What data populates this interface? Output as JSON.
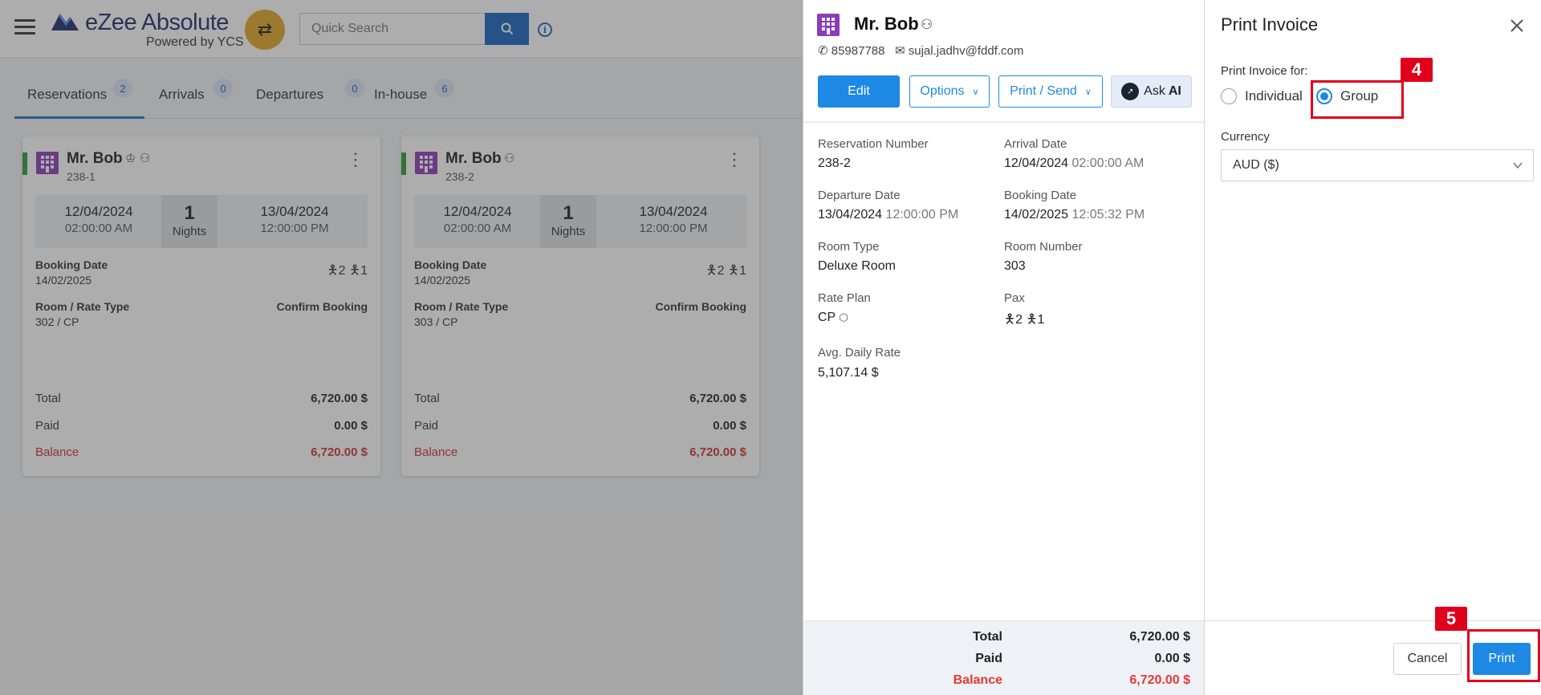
{
  "app": {
    "logo_title": "eZee Absolute",
    "logo_sub": "Powered by YCS",
    "search_placeholder": "Quick Search"
  },
  "tabs": [
    {
      "label": "Reservations",
      "count": "2",
      "active": true
    },
    {
      "label": "Arrivals",
      "count": "0"
    },
    {
      "label": "Departures",
      "count": "0"
    },
    {
      "label": "In-house",
      "count": "6"
    }
  ],
  "cards": [
    {
      "guest": "Mr. Bob",
      "res_no": "238-1",
      "arrival_date": "12/04/2024",
      "arrival_time": "02:00:00 AM",
      "nights": "1",
      "nights_label": "Nights",
      "departure_date": "13/04/2024",
      "departure_time": "12:00:00 PM",
      "booking_date_label": "Booking Date",
      "booking_date": "14/02/2025",
      "adults": "2",
      "children": "1",
      "room_rate_label": "Room / Rate Type",
      "room_rate": "302 / CP",
      "status": "Confirm Booking",
      "total_label": "Total",
      "total": "6,720.00 $",
      "paid_label": "Paid",
      "paid": "0.00 $",
      "balance_label": "Balance",
      "balance": "6,720.00 $"
    },
    {
      "guest": "Mr. Bob",
      "res_no": "238-2",
      "arrival_date": "12/04/2024",
      "arrival_time": "02:00:00 AM",
      "nights": "1",
      "nights_label": "Nights",
      "departure_date": "13/04/2024",
      "departure_time": "12:00:00 PM",
      "booking_date_label": "Booking Date",
      "booking_date": "14/02/2025",
      "adults": "2",
      "children": "1",
      "room_rate_label": "Room / Rate Type",
      "room_rate": "303 / CP",
      "status": "Confirm Booking",
      "total_label": "Total",
      "total": "6,720.00 $",
      "paid_label": "Paid",
      "paid": "0.00 $",
      "balance_label": "Balance",
      "balance": "6,720.00 $"
    }
  ],
  "detail": {
    "name": "Mr. Bob",
    "phone": "85987788",
    "email": "sujal.jadhv@fddf.com",
    "buttons": {
      "edit": "Edit",
      "options": "Options",
      "print_send": "Print / Send",
      "ask": "Ask",
      "ai": "AI"
    },
    "fields": {
      "reservation_number_label": "Reservation Number",
      "reservation_number": "238-2",
      "arrival_date_label": "Arrival Date",
      "arrival_date": "12/04/2024",
      "arrival_time": "02:00:00 AM",
      "departure_date_label": "Departure Date",
      "departure_date": "13/04/2024",
      "departure_time": "12:00:00 PM",
      "booking_date_label": "Booking Date",
      "booking_date": "14/02/2025",
      "booking_time": "12:05:32 PM",
      "room_type_label": "Room Type",
      "room_type": "Deluxe Room",
      "room_number_label": "Room Number",
      "room_number": "303",
      "rate_plan_label": "Rate Plan",
      "rate_plan": "CP",
      "pax_label": "Pax",
      "adults": "2",
      "children": "1",
      "adr_label": "Avg. Daily Rate",
      "adr": "5,107.14 $"
    },
    "footer": {
      "total_label": "Total",
      "total": "6,720.00 $",
      "paid_label": "Paid",
      "paid": "0.00 $",
      "balance_label": "Balance",
      "balance": "6,720.00 $"
    }
  },
  "print_invoice": {
    "title": "Print Invoice",
    "for_label": "Print Invoice for:",
    "options": [
      {
        "label": "Individual",
        "checked": false
      },
      {
        "label": "Group",
        "checked": true
      }
    ],
    "currency_label": "Currency",
    "currency_value": "AUD ($)",
    "cancel": "Cancel",
    "print": "Print"
  },
  "annotations": {
    "step_group": "4",
    "step_print": "5"
  },
  "colors": {
    "primary": "#1e88e5",
    "balance_red": "#e53935",
    "annotation_red": "#e0001b",
    "accent_green": "#2e9c3b",
    "shuffle_yellow": "#e0a826"
  }
}
